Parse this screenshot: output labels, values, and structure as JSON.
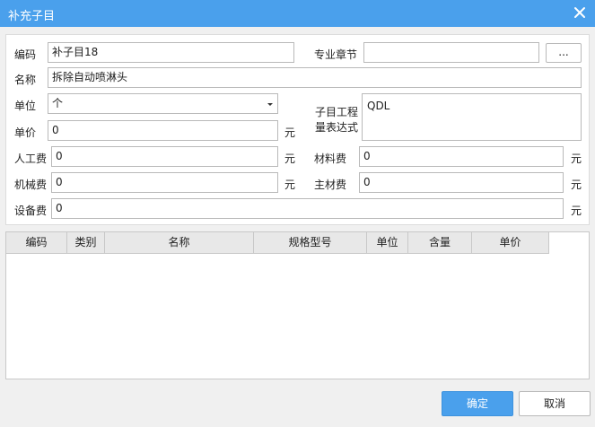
{
  "dialog": {
    "title": "补充子目",
    "close_icon": "close-icon"
  },
  "form": {
    "code_label": "编码",
    "code_value": "补子目18",
    "chapter_label": "专业章节",
    "chapter_value": "",
    "chapter_button": "...",
    "name_label": "名称",
    "name_value": "拆除自动喷淋头",
    "unit_label": "单位",
    "unit_value": "个",
    "expr_label_line1": "子目工程",
    "expr_label_line2": "量表达式",
    "expr_value": "QDL",
    "price_label": "单价",
    "price_value": "0",
    "labor_label": "人工费",
    "labor_value": "0",
    "material_label": "材料费",
    "material_value": "0",
    "machine_label": "机械费",
    "machine_value": "0",
    "main_material_label": "主材费",
    "main_material_value": "0",
    "equipment_label": "设备费",
    "equipment_value": "0",
    "currency": "元"
  },
  "grid": {
    "columns": [
      "编码",
      "类别",
      "名称",
      "规格型号",
      "单位",
      "含量",
      "单价"
    ],
    "rows": []
  },
  "buttons": {
    "ok": "确定",
    "cancel": "取消"
  },
  "colors": {
    "accent": "#4aa0ec"
  }
}
